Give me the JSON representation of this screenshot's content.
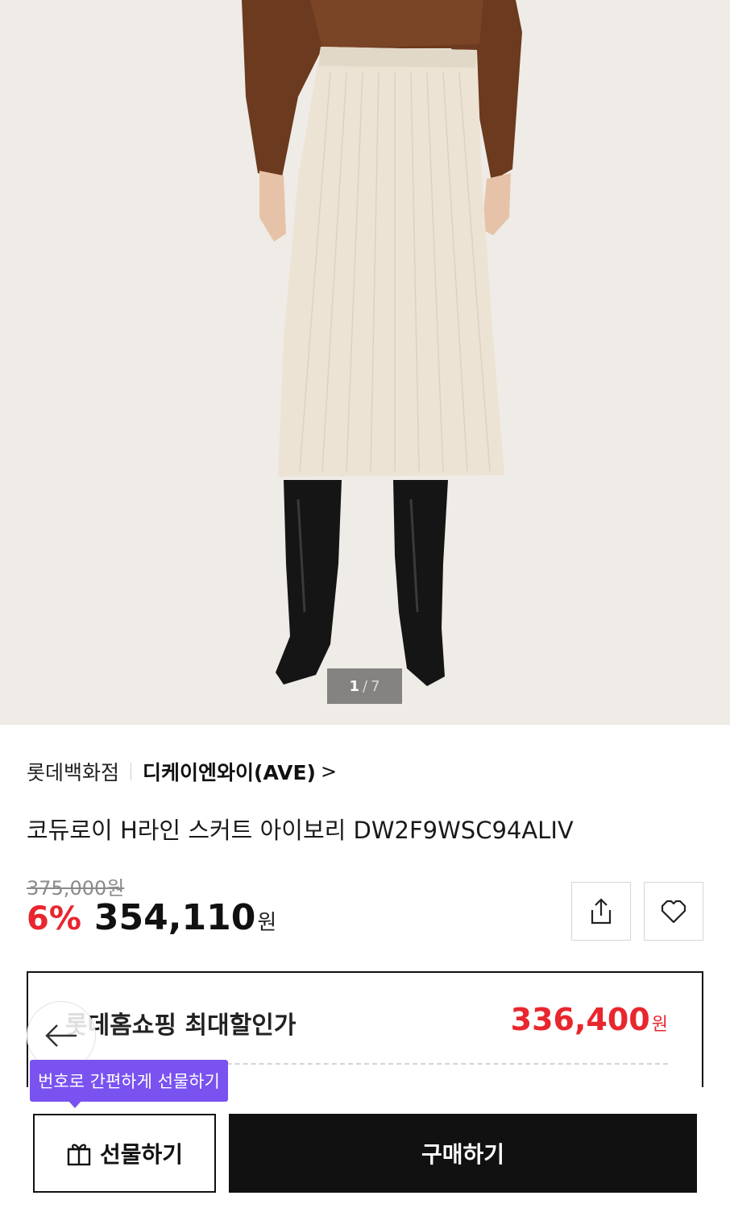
{
  "gallery": {
    "current": "1",
    "separator": "/",
    "total": "7"
  },
  "brand": {
    "store": "롯데백화점",
    "name": "디케이엔와이(AVE)",
    "chevron": ">"
  },
  "product": {
    "name": "코듀로이 H라인 스커트 아이보리 DW2F9WSC94ALIV"
  },
  "pricing": {
    "original": "375,000원",
    "discount": "6%",
    "price": "354,110",
    "currency": "원"
  },
  "actions": {
    "share_icon": "share-icon",
    "wishlist_icon": "heart-icon"
  },
  "promo": {
    "label": "롯데홈쇼핑 최대할인가",
    "price": "336,400",
    "currency": "원"
  },
  "bottom": {
    "tooltip": "번호로 간편하게 선물하기",
    "gift_label": "선물하기",
    "buy_label": "구매하기"
  },
  "colors": {
    "accent_red": "#e8262e",
    "tooltip_purple": "#7a52f0",
    "buy_button": "#111111"
  }
}
